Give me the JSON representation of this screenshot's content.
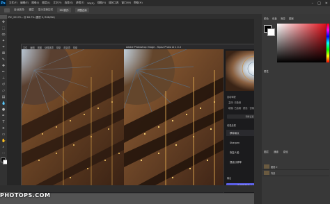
{
  "menubar": {
    "app_icon": "Ps",
    "items": [
      "文件(F)",
      "编辑(E)",
      "图像(I)",
      "图层(L)",
      "文字(Y)",
      "选择(S)",
      "滤镜(T)",
      "3D(D)",
      "视图(V)",
      "增效工具",
      "窗口(W)",
      "帮助(H)"
    ],
    "window_controls": [
      "–",
      "□",
      "×"
    ]
  },
  "optionsbar": {
    "labels": [
      "自动选择:",
      "图层",
      "显示变换控件"
    ],
    "buttons": [
      "3D 模式:",
      "调整边缘"
    ]
  },
  "doc_tab": "PIC_20170... @ 66.7% (图层 0, RGB/8#)",
  "dialog": {
    "title": "Adobe Photoshop Image - Topaz Photo AI 1.5.3",
    "menu": [
      "文件",
      "编辑",
      "视图",
      "处理选项",
      "帮助",
      "首选项",
      "帮助"
    ],
    "close": "×",
    "zoom_value": "1 图 (1 新)",
    "zoom_label": "预览已更新",
    "view_buttons": [
      "▭",
      "⊟",
      "⊞",
      "⋯"
    ],
    "right_panel": {
      "section1": "自动驾驶",
      "row_a": "主体: 已检测",
      "row_b": "增强: 已启用 · 锐化 · 去噪",
      "box": "调整设置以改善照片",
      "section2": "增强处理",
      "items": [
        {
          "label": "移除噪点",
          "on": true
        },
        {
          "label": "Sharpen",
          "on": true
        },
        {
          "label": "恢复人脸",
          "on": false
        },
        {
          "label": "提高分辨率",
          "on": false
        }
      ],
      "export_label": "输出",
      "apply_button": "应用并保存 Adobe Photoshop"
    }
  },
  "panels": {
    "tabs": [
      "颜色",
      "色板",
      "渐变",
      "图案"
    ],
    "properties_tab": "属性",
    "layers_tabs": [
      "图层",
      "通道",
      "路径"
    ],
    "layers": [
      {
        "name": "图层 0"
      },
      {
        "name": "背景"
      }
    ]
  },
  "watermark": "PHOTOPS.COM"
}
